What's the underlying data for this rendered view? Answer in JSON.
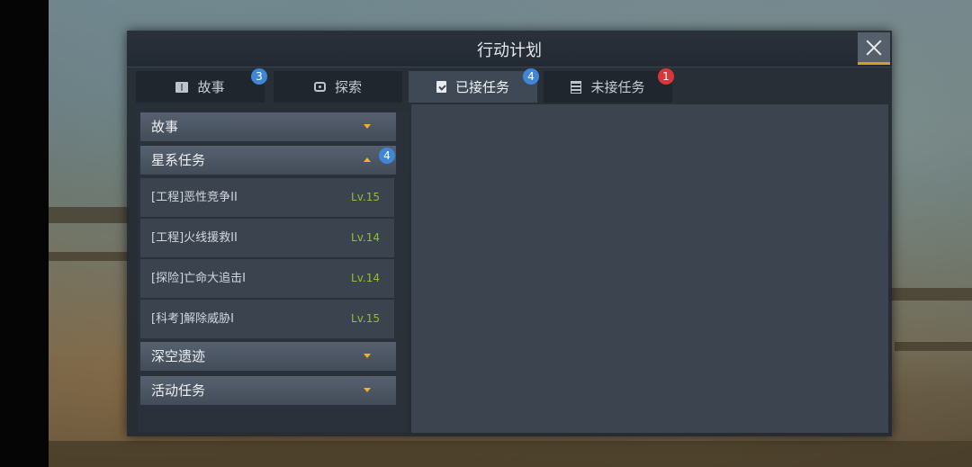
{
  "window": {
    "title": "行动计划"
  },
  "tabs": [
    {
      "label": "故事",
      "icon": "book-icon",
      "badge": "3",
      "badge_color": "#3f86d6",
      "active": false
    },
    {
      "label": "探索",
      "icon": "explore-icon",
      "badge": "",
      "active": false
    },
    {
      "label": "已接任务",
      "icon": "clipboard-check-icon",
      "badge": "4",
      "badge_color": "#3f86d6",
      "active": true
    },
    {
      "label": "未接任务",
      "icon": "list-icon",
      "badge": "1",
      "badge_color": "#d9363b",
      "active": false
    }
  ],
  "categories": [
    {
      "label": "故事",
      "expanded": false
    },
    {
      "label": "星系任务",
      "expanded": true,
      "badge": "4"
    },
    {
      "label": "深空遗迹",
      "expanded": false
    },
    {
      "label": "活动任务",
      "expanded": false
    }
  ],
  "quests": [
    {
      "name": "[工程]恶性竞争II",
      "level": "Lv.15"
    },
    {
      "name": "[工程]火线援救II",
      "level": "Lv.14"
    },
    {
      "name": "[探险]亡命大追击I",
      "level": "Lv.14"
    },
    {
      "name": "[科考]解除威胁I",
      "level": "Lv.15"
    }
  ],
  "colors": {
    "accent": "#f2b11e",
    "level": "#8fc02e",
    "badge_blue": "#3f86d6",
    "badge_red": "#d9363b"
  }
}
